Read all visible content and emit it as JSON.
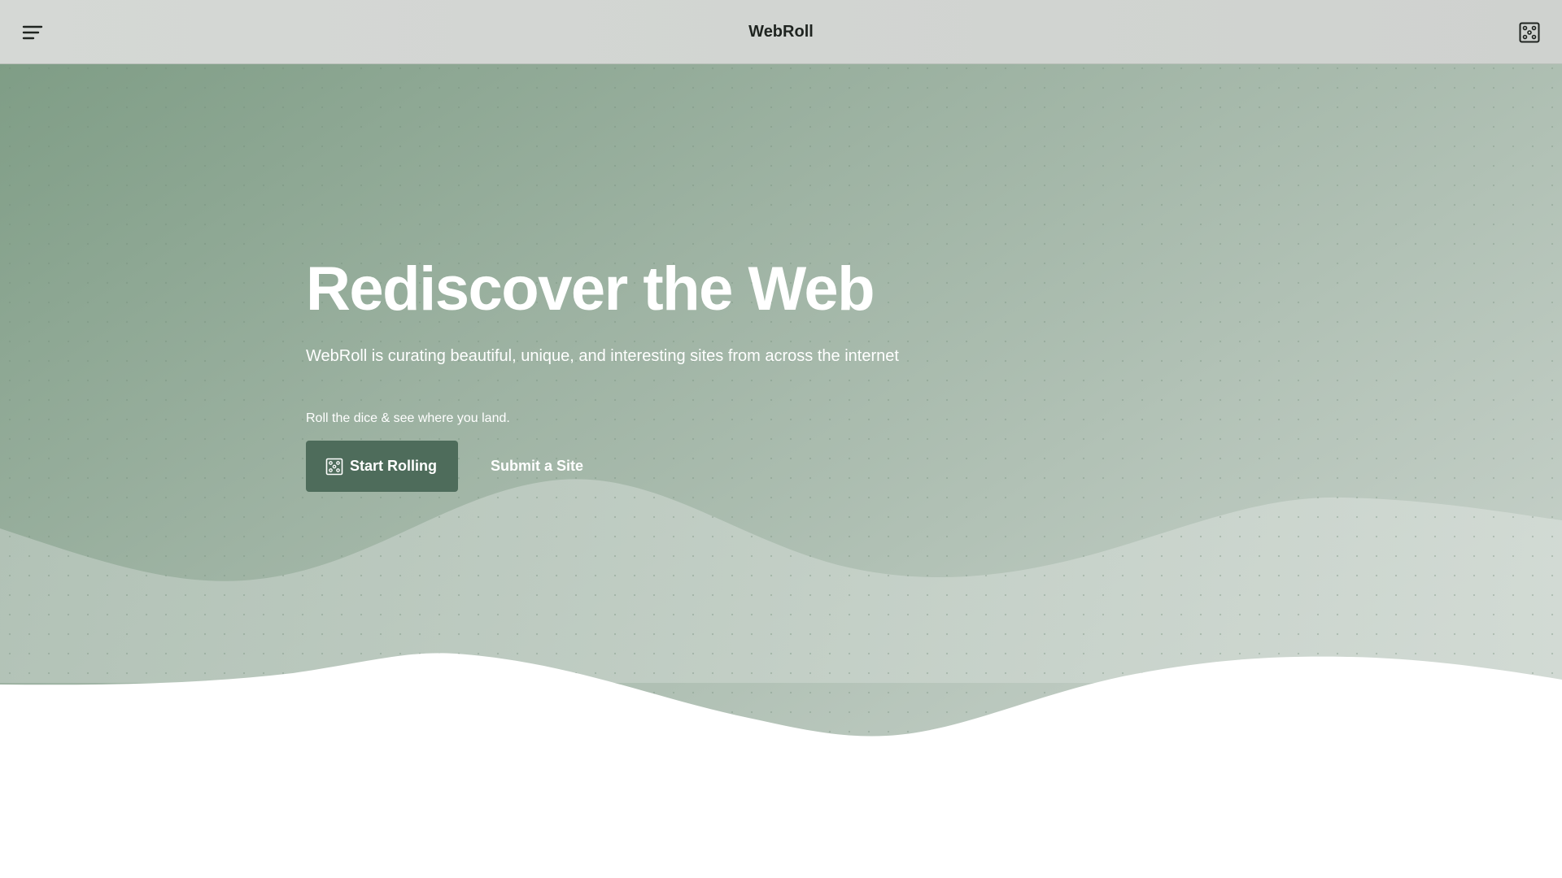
{
  "header": {
    "menu_icon": "menu-icon",
    "title": "WebRoll",
    "dice_icon": "dice-icon"
  },
  "hero": {
    "headline": "Rediscover the Web",
    "subheadline": "WebRoll is curating beautiful, unique, and interesting sites from across the internet",
    "cta_note": "Roll the dice & see where you land.",
    "start_button_label": "Start Rolling",
    "start_button_icon": "dice-icon",
    "submit_link_label": "Submit a Site"
  },
  "colors": {
    "hero_gradient_start": "#7f9e86",
    "hero_gradient_end": "#bcc9c0",
    "wave_light": "#c9d4cc",
    "button_bg": "#4e6c5b",
    "header_bg": "#d3d6d3"
  }
}
